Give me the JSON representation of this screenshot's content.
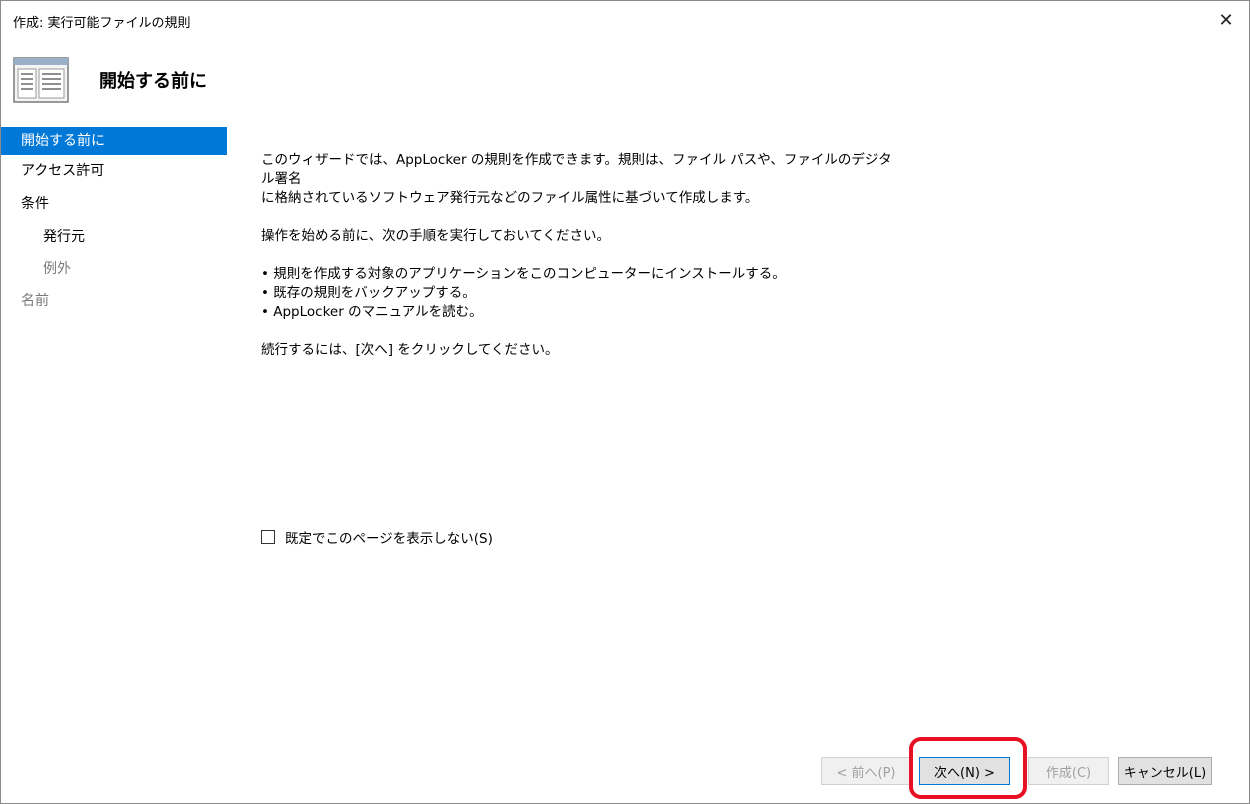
{
  "window": {
    "title": "作成: 実行可能ファイルの規則",
    "close_glyph": "✕"
  },
  "header": {
    "title": "開始する前に",
    "icon": "wizard-window-icon"
  },
  "sidebar": {
    "items": [
      {
        "label": "開始する前に",
        "state": "active"
      },
      {
        "label": "アクセス許可",
        "state": "normal"
      },
      {
        "label": "条件",
        "state": "normal"
      },
      {
        "label": "発行元",
        "state": "normal"
      },
      {
        "label": "例外",
        "state": "disabled"
      },
      {
        "label": "名前",
        "state": "disabled"
      }
    ]
  },
  "content": {
    "intro_line1": "このウィザードでは、AppLocker の規則を作成できます。規則は、ファイル パスや、ファイルのデジタル署名",
    "intro_line2": "に格納されているソフトウェア発行元などのファイル属性に基づいて作成します。",
    "before_start": "操作を始める前に、次の手順を実行しておいてください。",
    "bullets": [
      "• 規則を作成する対象のアプリケーションをこのコンピューターにインストールする。",
      "• 既存の規則をバックアップする。",
      "• AppLocker のマニュアルを読む。"
    ],
    "continue_text": "続行するには、[次へ] をクリックしてください。"
  },
  "checkbox": {
    "label": "既定でこのページを表示しない(S)",
    "checked": false
  },
  "buttons": {
    "back": "< 前へ(P)",
    "next": "次へ(N) >",
    "create": "作成(C)",
    "cancel": "キャンセル(L)"
  },
  "colors": {
    "accent": "#0078d7",
    "highlight": "#e81123"
  }
}
